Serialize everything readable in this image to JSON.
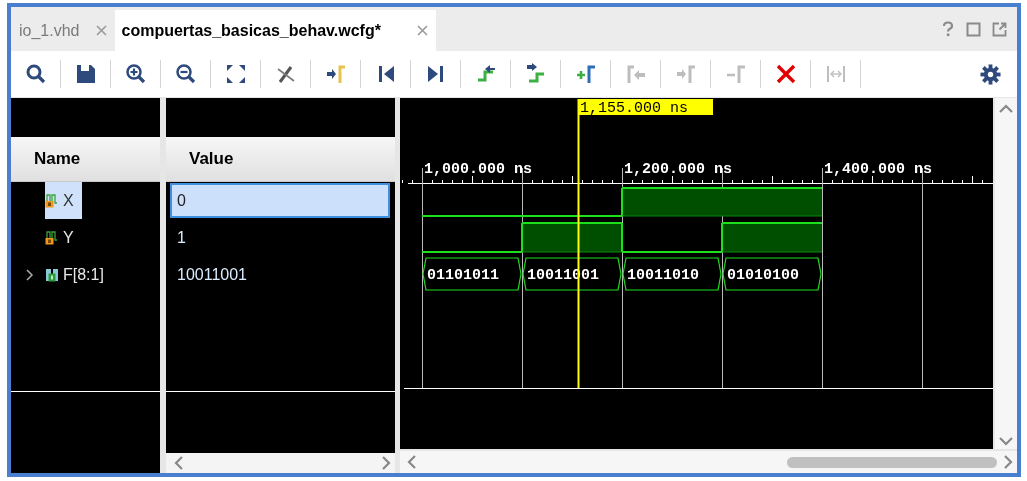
{
  "tabs": [
    {
      "label": "io_1.vhd",
      "selected": false
    },
    {
      "label": "compuertas_basicas_behav.wcfg*",
      "selected": true
    }
  ],
  "toolbar": [
    {
      "kind": "search",
      "disabled": false
    },
    {
      "kind": "save",
      "disabled": false
    },
    {
      "kind": "zoom-in",
      "disabled": false
    },
    {
      "kind": "zoom-out",
      "disabled": false
    },
    {
      "kind": "fit",
      "disabled": false
    },
    {
      "kind": "snap",
      "disabled": false
    },
    {
      "kind": "goto-cursor",
      "disabled": false
    },
    {
      "kind": "first",
      "disabled": false
    },
    {
      "kind": "last",
      "disabled": false
    },
    {
      "kind": "swap-prev",
      "disabled": false
    },
    {
      "kind": "swap-next",
      "disabled": false
    },
    {
      "kind": "add-marker",
      "disabled": false
    },
    {
      "kind": "prev-marker",
      "disabled": true
    },
    {
      "kind": "next-marker",
      "disabled": true
    },
    {
      "kind": "remove-marker",
      "disabled": true
    },
    {
      "kind": "delete",
      "disabled": false
    },
    {
      "kind": "measure",
      "disabled": true
    }
  ],
  "columns": [
    "Name",
    "Value"
  ],
  "signals": [
    {
      "name": "X",
      "value": "0",
      "kind": "bit",
      "selected": true,
      "wave": [
        {
          "high": false
        },
        {
          "high": false
        },
        {
          "high": true
        },
        {
          "high": true
        }
      ]
    },
    {
      "name": "Y",
      "value": "1",
      "kind": "bit",
      "selected": false,
      "wave": [
        {
          "high": false
        },
        {
          "high": true
        },
        {
          "high": false
        },
        {
          "high": true
        }
      ]
    },
    {
      "name": "F[8:1]",
      "value": "10011001",
      "kind": "bus",
      "selected": false,
      "expanded": false,
      "wave": [
        {
          "value": "01101011"
        },
        {
          "value": "10011001"
        },
        {
          "value": "10011010"
        },
        {
          "value": "01010100"
        }
      ]
    }
  ],
  "cursor": {
    "label": "1,155.000 ns"
  },
  "ruler": [
    "1,000.000 ns",
    "1,200.000 ns",
    "1,400.000 ns"
  ]
}
